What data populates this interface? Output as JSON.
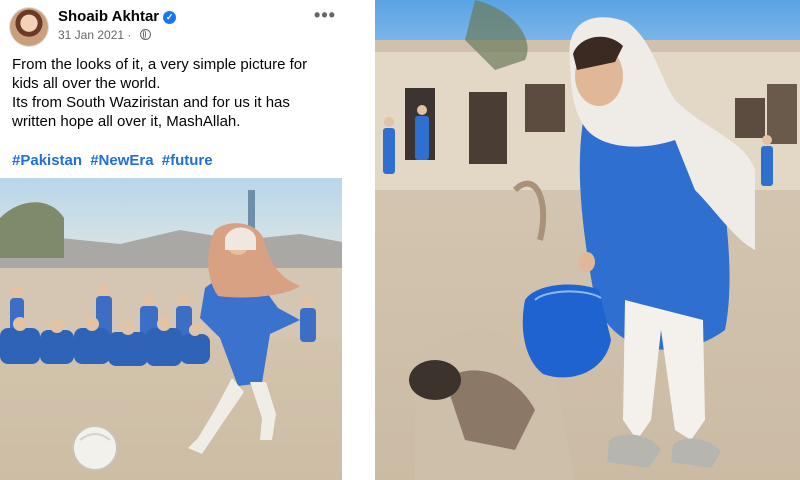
{
  "post": {
    "author": "Shoaib Akhtar",
    "verified_icon": "verified-badge-icon",
    "date": "31 Jan 2021",
    "privacy_icon": "globe-icon",
    "more_icon": "more-options-icon",
    "more_label": "•••",
    "text_lines": [
      "From the looks of it, a very simple picture for kids all over the world.",
      "Its from South Waziristan and for us it has written hope all over it, MashAllah."
    ],
    "hashtags": [
      "#Pakistan",
      "#NewEra",
      "#future"
    ]
  },
  "photos": {
    "left": "photo-girl-kicking-football",
    "right": "photo-girl-with-blue-bag"
  },
  "colors": {
    "link": "#216fdb",
    "verified": "#1877f2",
    "uniform_blue": "#2f6fcf"
  }
}
